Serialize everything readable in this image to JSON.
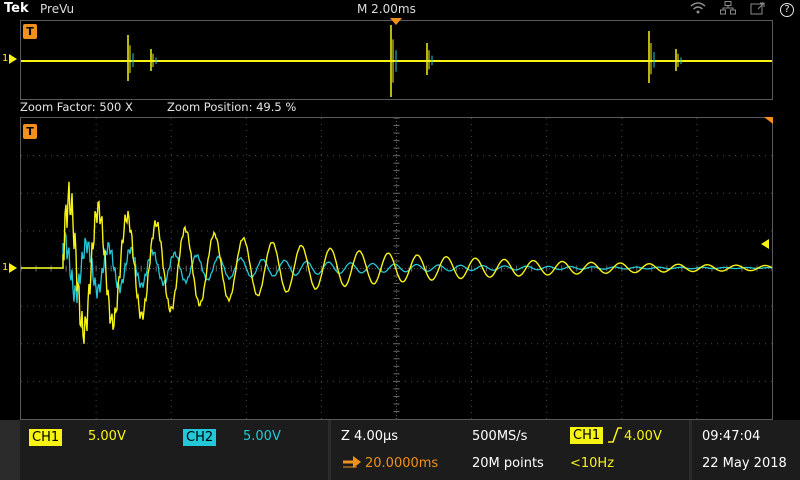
{
  "header": {
    "brand": "Tek",
    "mode": "PreVu",
    "timebase": "M 2.00ms",
    "status_icons": [
      "wifi-icon",
      "network-icon",
      "export-icon",
      "help-icon"
    ],
    "help_glyph": "?"
  },
  "markers": {
    "trigger_label": "T",
    "ch1_level_label": "1"
  },
  "zoom": {
    "factor_label": "Zoom Factor: 500 X",
    "position_label": "Zoom Position: 49.5 %"
  },
  "colors": {
    "ch1": "#f7f414",
    "ch2": "#22c8d8",
    "trigger": "#f2901c",
    "grid": "#4a4a4a"
  },
  "bottom": {
    "ch1": {
      "label": "CH1",
      "scale": "5.00V"
    },
    "ch2": {
      "label": "CH2",
      "scale": "5.00V"
    },
    "horizontal": {
      "scale": "Z 4.00µs",
      "sample_rate": "500MS/s",
      "delay": "20.0000ms",
      "record_length": "20M points"
    },
    "trigger": {
      "source": "CH1",
      "level": "4.00V",
      "frequency": "<10Hz"
    },
    "clock": {
      "time": "09:47:04",
      "date": "22 May 2018"
    }
  }
}
